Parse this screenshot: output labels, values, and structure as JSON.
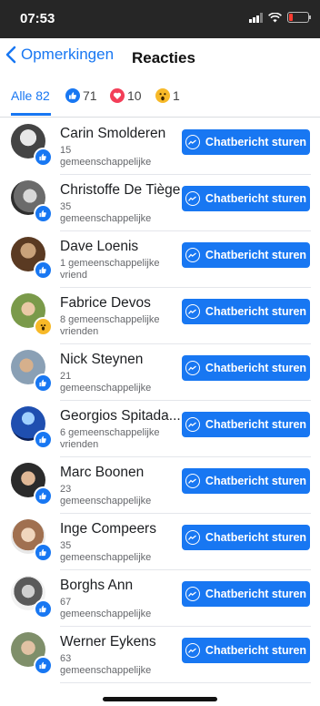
{
  "status": {
    "time": "07:53",
    "icons": [
      "signal-icon",
      "wifi-icon",
      "battery-icon"
    ]
  },
  "nav": {
    "back_label": "Opmerkingen",
    "title": "Reacties"
  },
  "tabs": [
    {
      "label": "Alle 82",
      "icon": ""
    },
    {
      "label": "71",
      "icon": "like-icon"
    },
    {
      "label": "10",
      "icon": "love-icon"
    },
    {
      "label": "1",
      "icon": "wow-icon"
    }
  ],
  "button_label": "Chatbericht sturen",
  "colors": {
    "accent": "#1877f2",
    "love": "#f33e58",
    "wow": "#f7b928",
    "statusbar": "#262626"
  },
  "people": [
    {
      "name": "Carin Smolderen",
      "mutual_count": "15",
      "mutual_label": "gemeenschappelijke",
      "reaction": "like"
    },
    {
      "name": "Christoffe De Tiège",
      "mutual_count": "35",
      "mutual_label": "gemeenschappelijke",
      "reaction": "like"
    },
    {
      "name": "Dave Loenis",
      "mutual_count": "1 gemeenschappelijke",
      "mutual_label": "vriend",
      "reaction": "like"
    },
    {
      "name": "Fabrice Devos",
      "mutual_count": "8 gemeenschappelijke",
      "mutual_label": "vrienden",
      "reaction": "wow"
    },
    {
      "name": "Nick Steynen",
      "mutual_count": "21",
      "mutual_label": "gemeenschappelijke",
      "reaction": "like"
    },
    {
      "name": "Georgios Spitada...",
      "mutual_count": "6 gemeenschappelijke",
      "mutual_label": "vrienden",
      "reaction": "like"
    },
    {
      "name": "Marc Boonen",
      "mutual_count": "23",
      "mutual_label": "gemeenschappelijke",
      "reaction": "like"
    },
    {
      "name": "Inge Compeers",
      "mutual_count": "35",
      "mutual_label": "gemeenschappelijke",
      "reaction": "like"
    },
    {
      "name": "Borghs Ann",
      "mutual_count": "67",
      "mutual_label": "gemeenschappelijke",
      "reaction": "like"
    },
    {
      "name": "Werner Eykens",
      "mutual_count": "63",
      "mutual_label": "gemeenschappelijke",
      "reaction": "like"
    }
  ]
}
